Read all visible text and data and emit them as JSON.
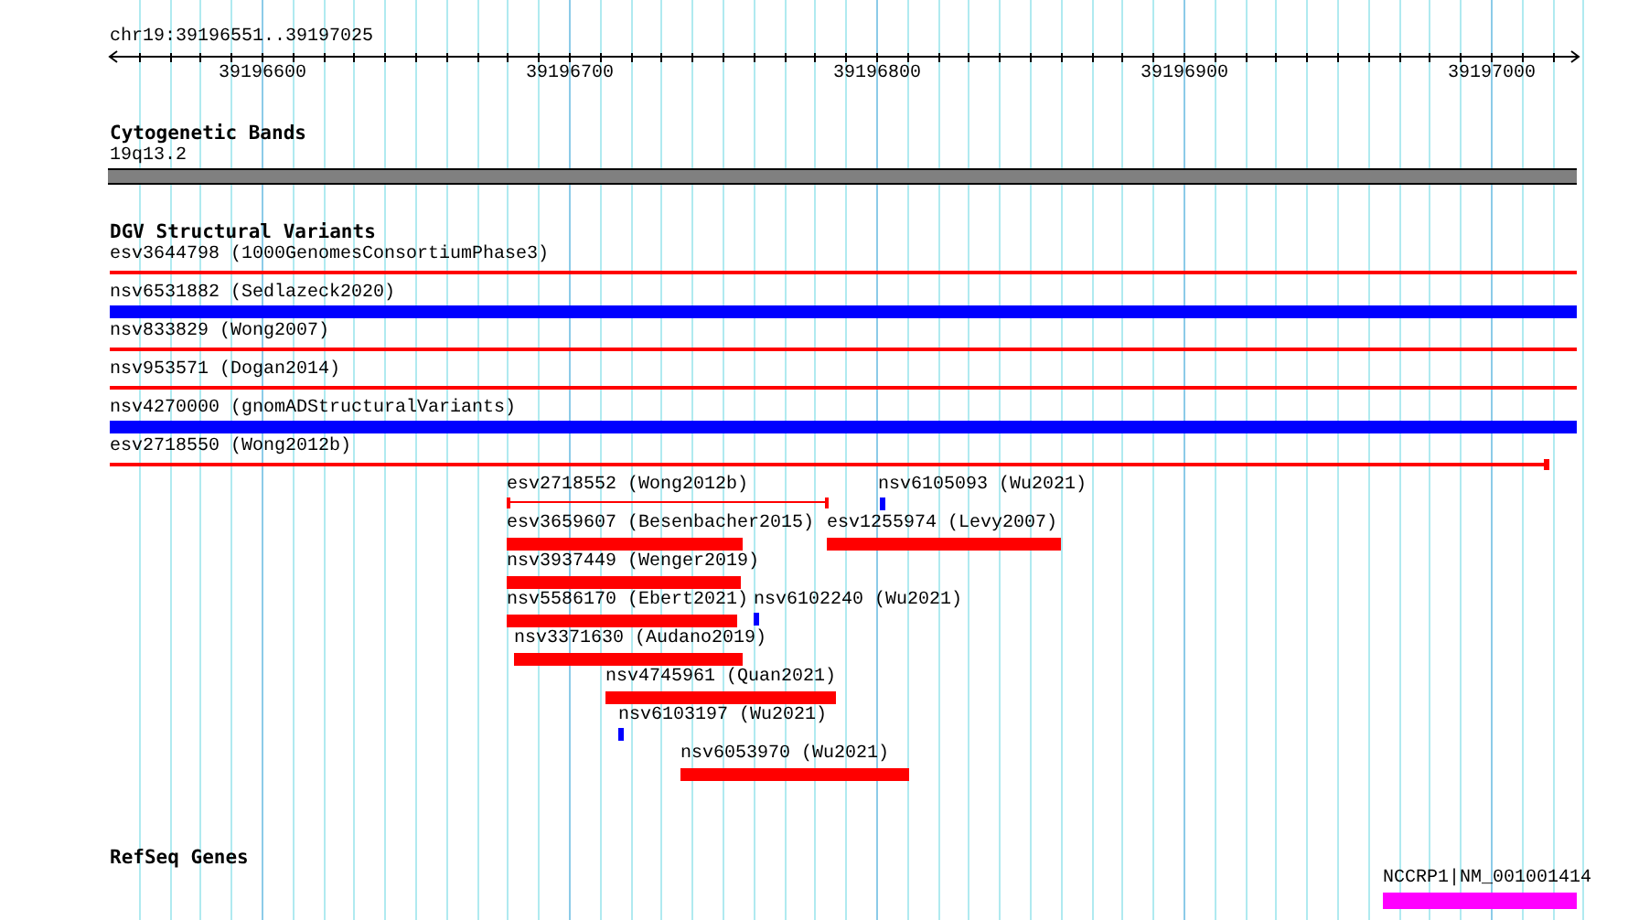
{
  "ruler": {
    "region": "chr19:39196551..39197025",
    "ticks": [
      "39196600",
      "39196700",
      "39196800",
      "39196900",
      "39197000"
    ]
  },
  "cytogenetic_bands": {
    "title": "Cytogenetic Bands",
    "bands": [
      {
        "label": "19q13.2"
      }
    ]
  },
  "dgv_structural_variants": {
    "title": "DGV Structural Variants",
    "variants": [
      {
        "label": "esv3644798 (1000GenomesConsortiumPhase3)",
        "kind": "line",
        "color": "#ff0000"
      },
      {
        "label": "nsv6531882 (Sedlazeck2020)",
        "kind": "bar",
        "color": "#0000ff"
      },
      {
        "label": "nsv833829 (Wong2007)",
        "kind": "line",
        "color": "#ff0000"
      },
      {
        "label": "nsv953571 (Dogan2014)",
        "kind": "line",
        "color": "#ff0000"
      },
      {
        "label": "nsv4270000 (gnomADStructuralVariants)",
        "kind": "bar",
        "color": "#0000ff"
      },
      {
        "label": "esv2718550 (Wong2012b)",
        "kind": "capped",
        "color": "#ff0000"
      },
      {
        "label": "esv2718552 (Wong2012b)",
        "kind": "bracket",
        "color": "#ff0000"
      },
      {
        "label": "nsv6105093 (Wu2021)",
        "kind": "mark",
        "color": "#0000ff"
      },
      {
        "label": "esv3659607 (Besenbacher2015)",
        "kind": "bar",
        "color": "#ff0000"
      },
      {
        "label": "esv1255974 (Levy2007)",
        "kind": "bar",
        "color": "#ff0000"
      },
      {
        "label": "nsv3937449 (Wenger2019)",
        "kind": "bar",
        "color": "#ff0000"
      },
      {
        "label": "nsv5586170 (Ebert2021)",
        "kind": "bar",
        "color": "#ff0000"
      },
      {
        "label": "nsv6102240 (Wu2021)",
        "kind": "mark",
        "color": "#0000ff"
      },
      {
        "label": "nsv3371630 (Audano2019)",
        "kind": "bar",
        "color": "#ff0000"
      },
      {
        "label": "nsv4745961 (Quan2021)",
        "kind": "bar",
        "color": "#ff0000"
      },
      {
        "label": "nsv6103197 (Wu2021)",
        "kind": "mark",
        "color": "#0000ff"
      },
      {
        "label": "nsv6053970 (Wu2021)",
        "kind": "bar",
        "color": "#ff0000"
      }
    ]
  },
  "refseq_genes": {
    "title": "RefSeq Genes",
    "genes": [
      {
        "label": "NCCRP1|NM_001001414",
        "color": "#ff00ff"
      }
    ]
  }
}
